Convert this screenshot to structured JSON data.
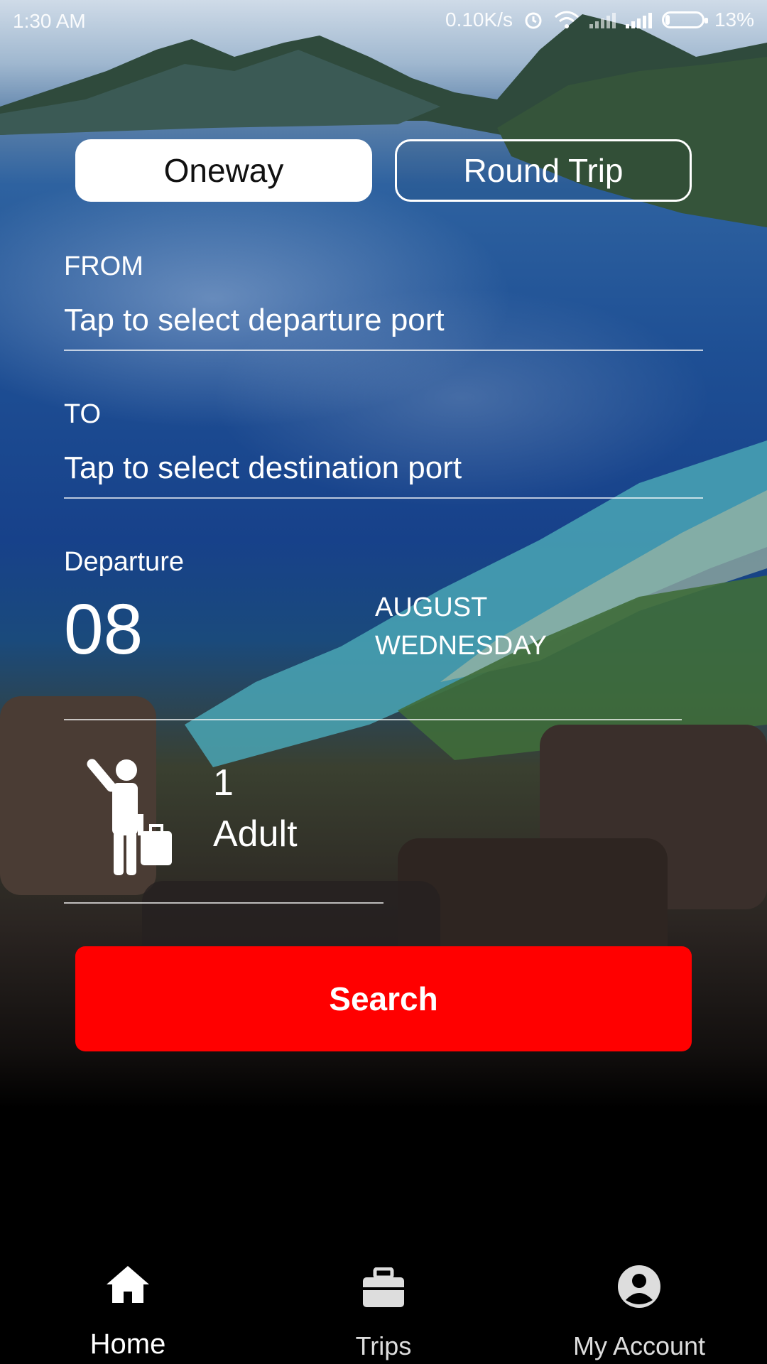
{
  "status_bar": {
    "time": "1:30 AM",
    "speed": "0.10K/s",
    "battery": "13%"
  },
  "trip_type": {
    "oneway_label": "Oneway",
    "roundtrip_label": "Round Trip",
    "selected": "Oneway"
  },
  "from": {
    "label": "FROM",
    "placeholder": "Tap to select departure port"
  },
  "to": {
    "label": "TO",
    "placeholder": "Tap to select destination port"
  },
  "departure": {
    "label": "Departure",
    "day": "08",
    "month": "AUGUST",
    "weekday": "WEDNESDAY"
  },
  "passengers": {
    "count": "1",
    "type": "Adult"
  },
  "search_button": "Search",
  "bottom_nav": {
    "home": "Home",
    "trips": "Trips",
    "account": "My Account"
  },
  "colors": {
    "accent": "#ff0000",
    "text": "#ffffff"
  }
}
